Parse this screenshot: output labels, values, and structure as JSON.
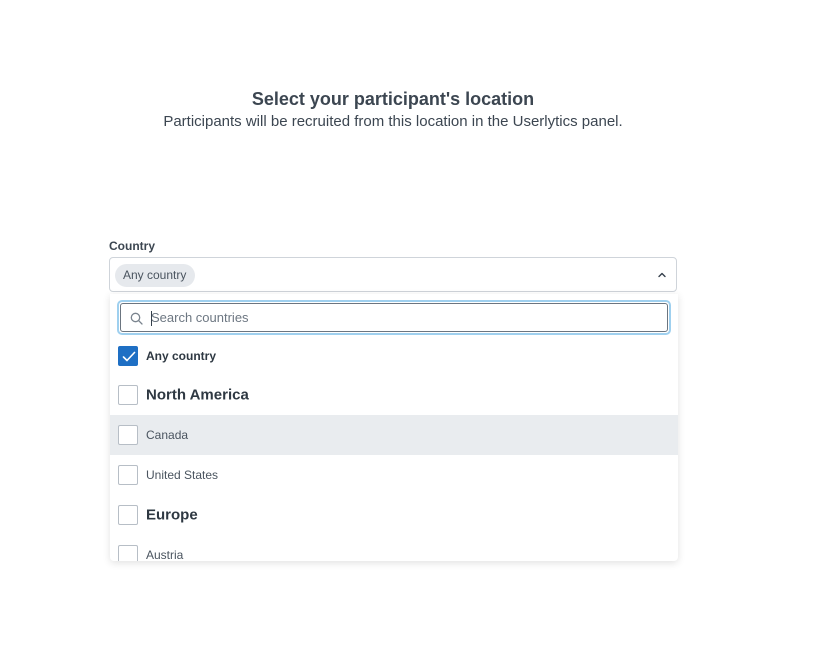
{
  "header": {
    "title": "Select your participant's location",
    "subtitle": "Participants will be recruited from this location in the Userlytics panel."
  },
  "country_field": {
    "label": "Country",
    "selected_chip": "Any country",
    "chevron_icon": "chevron-up-icon",
    "search": {
      "placeholder": "Search countries",
      "value": "",
      "icon": "search-icon"
    },
    "options": [
      {
        "label": "Any country",
        "checked": true,
        "kind": "option-bold"
      },
      {
        "label": "North America",
        "checked": false,
        "kind": "group"
      },
      {
        "label": "Canada",
        "checked": false,
        "kind": "option",
        "highlighted": true
      },
      {
        "label": "United States",
        "checked": false,
        "kind": "option"
      },
      {
        "label": "Europe",
        "checked": false,
        "kind": "group"
      },
      {
        "label": "Austria",
        "checked": false,
        "kind": "option"
      }
    ]
  },
  "colors": {
    "accent": "#1e6fc4",
    "focus_ring": "#9fd0ef",
    "highlight_row": "#e9ecef",
    "chip_bg": "#e6e9ed",
    "text": "#3c4651"
  }
}
